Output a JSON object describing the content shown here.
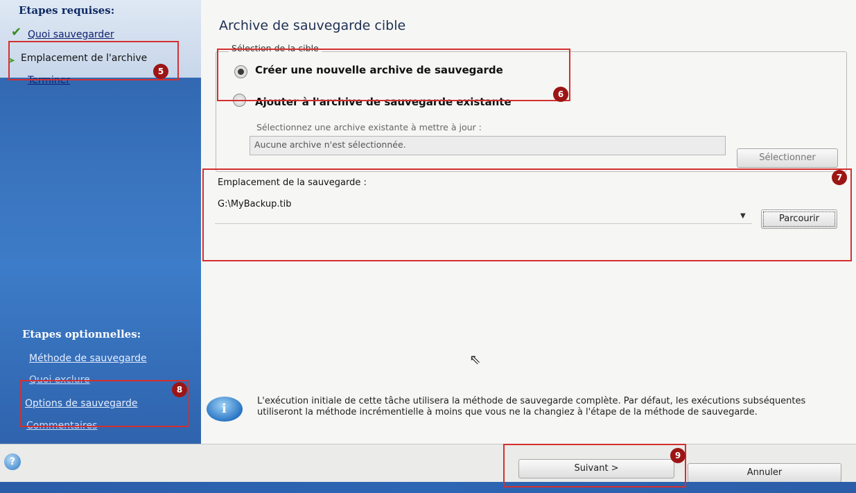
{
  "sidebar": {
    "required_heading": "Etapes requises:",
    "required_items": [
      {
        "label": "Quoi sauvegarder"
      },
      {
        "label": "Emplacement de l'archive"
      },
      {
        "label": "Terminer"
      }
    ],
    "optional_heading": "Etapes optionnelles:",
    "optional_items": [
      {
        "label": "Méthode de sauvegarde"
      },
      {
        "label": "Quoi exclure"
      },
      {
        "label": "Options de sauvegarde"
      },
      {
        "label": "Commentaires"
      }
    ]
  },
  "main": {
    "title": "Archive de sauvegarde cible",
    "target_group": {
      "legend": "Sélection de la cible",
      "option_new": "Créer une nouvelle archive de sauvegarde",
      "option_existing": "Ajouter à l'archive de sauvegarde existante",
      "existing_prompt": "Sélectionnez une archive existante à mettre à jour :",
      "existing_value": "Aucune archive n'est sélectionnée.",
      "select_button": "Sélectionner"
    },
    "location": {
      "label": "Emplacement de la sauvegarde :",
      "value": "G:\\MyBackup.tib",
      "browse_button": "Parcourir"
    },
    "info_text": "L'exécution initiale de cette tâche utilisera la méthode de sauvegarde complète. Par défaut, les exécutions subséquentes utiliseront la méthode incrémentielle à moins que vous ne la changiez à l'étape de la méthode de sauvegarde."
  },
  "footer": {
    "next_button": "Suivant >",
    "cancel_button": "Annuler"
  },
  "annotations": [
    "5",
    "6",
    "7",
    "8",
    "9"
  ],
  "colors": {
    "callout": "#d42f2f",
    "badge": "#9c1515",
    "sidebar": "#3a74bf"
  }
}
